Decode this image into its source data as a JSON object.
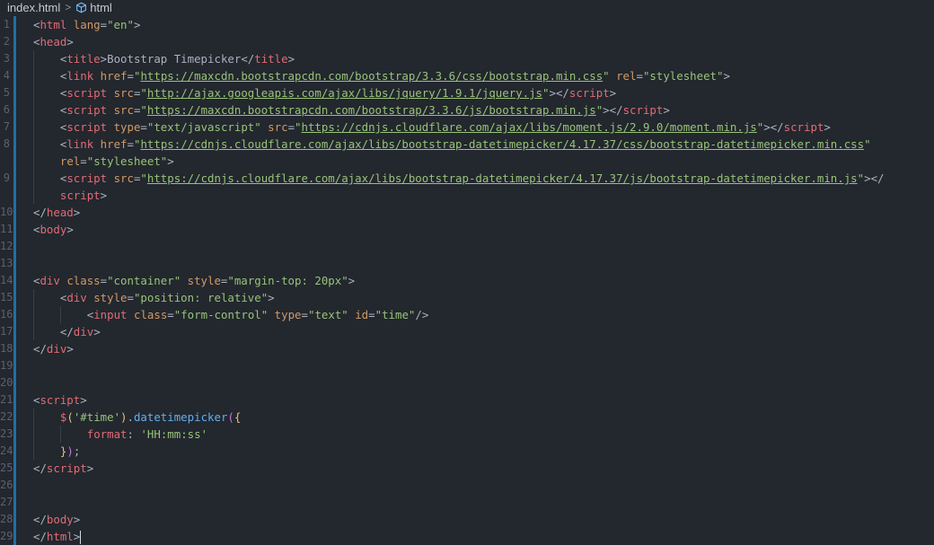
{
  "breadcrumb": {
    "file": "index.html",
    "separator": ">",
    "node": "html"
  },
  "lines": [
    {
      "n": "1",
      "indent": 0,
      "tokens": [
        [
          "p",
          "<"
        ],
        [
          "t",
          "html"
        ],
        [
          "a",
          " lang"
        ],
        [
          "p",
          "="
        ],
        [
          "s",
          "\"en\""
        ],
        [
          "p",
          ">"
        ]
      ]
    },
    {
      "n": "2",
      "indent": 0,
      "tokens": [
        [
          "p",
          "<"
        ],
        [
          "t",
          "head"
        ],
        [
          "p",
          ">"
        ]
      ]
    },
    {
      "n": "3",
      "indent": 1,
      "tokens": [
        [
          "p",
          "<"
        ],
        [
          "t",
          "title"
        ],
        [
          "p",
          ">"
        ],
        [
          "p",
          "Bootstrap Timepicker"
        ],
        [
          "p",
          "</"
        ],
        [
          "t",
          "title"
        ],
        [
          "p",
          ">"
        ]
      ]
    },
    {
      "n": "4",
      "indent": 1,
      "tokens": [
        [
          "p",
          "<"
        ],
        [
          "t",
          "link"
        ],
        [
          "a",
          " href"
        ],
        [
          "p",
          "="
        ],
        [
          "s",
          "\""
        ],
        [
          "u",
          "https://maxcdn.bootstrapcdn.com/bootstrap/3.3.6/css/bootstrap.min.css"
        ],
        [
          "s",
          "\""
        ],
        [
          "a",
          " rel"
        ],
        [
          "p",
          "="
        ],
        [
          "s",
          "\"stylesheet\""
        ],
        [
          "p",
          ">"
        ]
      ]
    },
    {
      "n": "5",
      "indent": 1,
      "tokens": [
        [
          "p",
          "<"
        ],
        [
          "t",
          "script"
        ],
        [
          "a",
          " src"
        ],
        [
          "p",
          "="
        ],
        [
          "s",
          "\""
        ],
        [
          "u",
          "http://ajax.googleapis.com/ajax/libs/jquery/1.9.1/jquery.js"
        ],
        [
          "s",
          "\""
        ],
        [
          "p",
          "></"
        ],
        [
          "t",
          "script"
        ],
        [
          "p",
          ">"
        ]
      ]
    },
    {
      "n": "6",
      "indent": 1,
      "tokens": [
        [
          "p",
          "<"
        ],
        [
          "t",
          "script"
        ],
        [
          "a",
          " src"
        ],
        [
          "p",
          "="
        ],
        [
          "s",
          "\""
        ],
        [
          "u",
          "https://maxcdn.bootstrapcdn.com/bootstrap/3.3.6/js/bootstrap.min.js"
        ],
        [
          "s",
          "\""
        ],
        [
          "p",
          "></"
        ],
        [
          "t",
          "script"
        ],
        [
          "p",
          ">"
        ]
      ]
    },
    {
      "n": "7",
      "indent": 1,
      "tokens": [
        [
          "p",
          "<"
        ],
        [
          "t",
          "script"
        ],
        [
          "a",
          " type"
        ],
        [
          "p",
          "="
        ],
        [
          "s",
          "\"text/javascript\""
        ],
        [
          "a",
          " src"
        ],
        [
          "p",
          "="
        ],
        [
          "s",
          "\""
        ],
        [
          "u",
          "https://cdnjs.cloudflare.com/ajax/libs/moment.js/2.9.0/moment.min.js"
        ],
        [
          "s",
          "\""
        ],
        [
          "p",
          "></"
        ],
        [
          "t",
          "script"
        ],
        [
          "p",
          ">"
        ]
      ]
    },
    {
      "n": "8",
      "indent": 1,
      "tokens": [
        [
          "p",
          "<"
        ],
        [
          "t",
          "link"
        ],
        [
          "a",
          " href"
        ],
        [
          "p",
          "="
        ],
        [
          "s",
          "\""
        ],
        [
          "u",
          "https://cdnjs.cloudflare.com/ajax/libs/bootstrap-datetimepicker/4.17.37/css/bootstrap-datetimepicker.min.css"
        ],
        [
          "s",
          "\""
        ]
      ]
    },
    {
      "n": "",
      "indent": 1,
      "tokens": [
        [
          "a",
          "rel"
        ],
        [
          "p",
          "="
        ],
        [
          "s",
          "\"stylesheet\""
        ],
        [
          "p",
          ">"
        ]
      ]
    },
    {
      "n": "9",
      "indent": 1,
      "tokens": [
        [
          "p",
          "<"
        ],
        [
          "t",
          "script"
        ],
        [
          "a",
          " src"
        ],
        [
          "p",
          "="
        ],
        [
          "s",
          "\""
        ],
        [
          "u",
          "https://cdnjs.cloudflare.com/ajax/libs/bootstrap-datetimepicker/4.17.37/js/bootstrap-datetimepicker.min.js"
        ],
        [
          "s",
          "\""
        ],
        [
          "p",
          "></"
        ]
      ]
    },
    {
      "n": "",
      "indent": 1,
      "tokens": [
        [
          "t",
          "script"
        ],
        [
          "p",
          ">"
        ]
      ]
    },
    {
      "n": "10",
      "indent": 0,
      "tokens": [
        [
          "p",
          "</"
        ],
        [
          "t",
          "head"
        ],
        [
          "p",
          ">"
        ]
      ]
    },
    {
      "n": "11",
      "indent": 0,
      "tokens": [
        [
          "p",
          "<"
        ],
        [
          "t",
          "body"
        ],
        [
          "p",
          ">"
        ]
      ]
    },
    {
      "n": "12",
      "indent": 0,
      "tokens": []
    },
    {
      "n": "13",
      "indent": 0,
      "tokens": []
    },
    {
      "n": "14",
      "indent": 0,
      "tokens": [
        [
          "p",
          "<"
        ],
        [
          "t",
          "div"
        ],
        [
          "a",
          " class"
        ],
        [
          "p",
          "="
        ],
        [
          "s",
          "\"container\""
        ],
        [
          "a",
          " style"
        ],
        [
          "p",
          "="
        ],
        [
          "s",
          "\"margin-top: 20px\""
        ],
        [
          "p",
          ">"
        ]
      ]
    },
    {
      "n": "15",
      "indent": 1,
      "tokens": [
        [
          "p",
          "<"
        ],
        [
          "t",
          "div"
        ],
        [
          "a",
          " style"
        ],
        [
          "p",
          "="
        ],
        [
          "s",
          "\"position: relative\""
        ],
        [
          "p",
          ">"
        ]
      ]
    },
    {
      "n": "16",
      "indent": 2,
      "tokens": [
        [
          "p",
          "<"
        ],
        [
          "t",
          "input"
        ],
        [
          "a",
          " class"
        ],
        [
          "p",
          "="
        ],
        [
          "s",
          "\"form-control\""
        ],
        [
          "a",
          " type"
        ],
        [
          "p",
          "="
        ],
        [
          "s",
          "\"text\""
        ],
        [
          "a",
          " id"
        ],
        [
          "p",
          "="
        ],
        [
          "s",
          "\"time\""
        ],
        [
          "p",
          "/>"
        ]
      ]
    },
    {
      "n": "17",
      "indent": 1,
      "tokens": [
        [
          "p",
          "</"
        ],
        [
          "t",
          "div"
        ],
        [
          "p",
          ">"
        ]
      ]
    },
    {
      "n": "18",
      "indent": 0,
      "tokens": [
        [
          "p",
          "</"
        ],
        [
          "t",
          "div"
        ],
        [
          "p",
          ">"
        ]
      ]
    },
    {
      "n": "19",
      "indent": 0,
      "tokens": []
    },
    {
      "n": "20",
      "indent": 0,
      "tokens": []
    },
    {
      "n": "21",
      "indent": 0,
      "tokens": [
        [
          "p",
          "<"
        ],
        [
          "t",
          "script"
        ],
        [
          "p",
          ">"
        ]
      ]
    },
    {
      "n": "22",
      "indent": 1,
      "tokens": [
        [
          "k",
          "$"
        ],
        [
          "b1",
          "("
        ],
        [
          "s",
          "'#time'"
        ],
        [
          "b1",
          ")"
        ],
        [
          "p",
          "."
        ],
        [
          "f",
          "datetimepicker"
        ],
        [
          "b2",
          "("
        ],
        [
          "b1",
          "{"
        ]
      ]
    },
    {
      "n": "23",
      "indent": 2,
      "tokens": [
        [
          "k",
          "format"
        ],
        [
          "p",
          ": "
        ],
        [
          "s",
          "'HH:mm:ss'"
        ]
      ]
    },
    {
      "n": "24",
      "indent": 1,
      "tokens": [
        [
          "b1",
          "}"
        ],
        [
          "b2",
          ")"
        ],
        [
          "p",
          ";"
        ]
      ]
    },
    {
      "n": "25",
      "indent": 0,
      "tokens": [
        [
          "p",
          "</"
        ],
        [
          "t",
          "script"
        ],
        [
          "p",
          ">"
        ]
      ]
    },
    {
      "n": "26",
      "indent": 0,
      "tokens": []
    },
    {
      "n": "27",
      "indent": 0,
      "tokens": []
    },
    {
      "n": "28",
      "indent": 0,
      "tokens": [
        [
          "p",
          "</"
        ],
        [
          "t",
          "body"
        ],
        [
          "p",
          ">"
        ]
      ]
    },
    {
      "n": "29",
      "indent": 0,
      "tokens": [
        [
          "p",
          "</"
        ],
        [
          "t",
          "html"
        ],
        [
          "p",
          ">"
        ]
      ],
      "cursor": true
    }
  ]
}
